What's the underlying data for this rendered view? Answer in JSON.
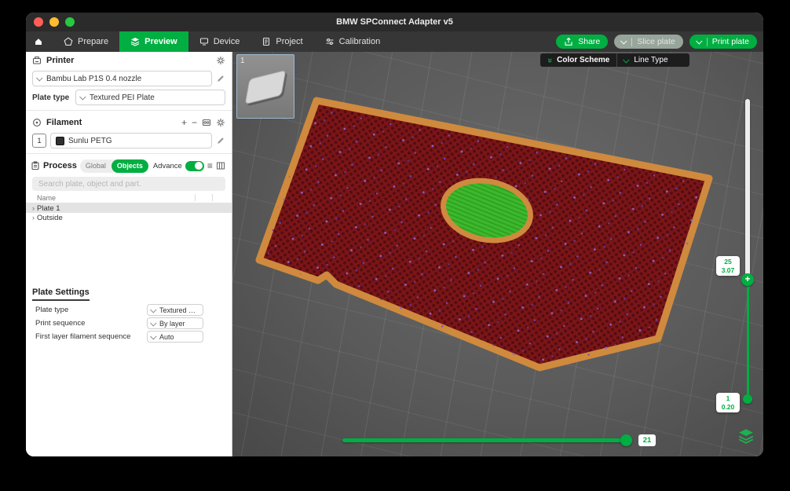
{
  "titlebar": {
    "title": "BMW SPConnect Adapter v5"
  },
  "tabbar": {
    "tabs": [
      {
        "label": "Prepare"
      },
      {
        "label": "Preview"
      },
      {
        "label": "Device"
      },
      {
        "label": "Project"
      },
      {
        "label": "Calibration"
      }
    ],
    "share_label": "Share",
    "slice_label": "Slice plate",
    "print_label": "Print plate"
  },
  "sidebar": {
    "printer": {
      "title": "Printer",
      "model": "Bambu Lab P1S 0.4 nozzle",
      "plate_type_label": "Plate type",
      "plate_type": "Textured PEI Plate"
    },
    "filament": {
      "title": "Filament",
      "slot": "1",
      "name": "Sunlu PETG"
    },
    "process": {
      "title": "Process",
      "seg_global": "Global",
      "seg_objects": "Objects",
      "advance": "Advance"
    },
    "search": {
      "placeholder": "Search plate, object and part."
    },
    "tree": {
      "name_header": "Name",
      "items": [
        {
          "label": "Plate 1"
        },
        {
          "label": "Outside"
        }
      ]
    },
    "plate_settings": {
      "title": "Plate Settings",
      "rows": [
        {
          "label": "Plate type",
          "value": "Textured PEI ..."
        },
        {
          "label": "Print sequence",
          "value": "By layer"
        },
        {
          "label": "First layer filament sequence",
          "value": "Auto"
        }
      ]
    }
  },
  "viewport": {
    "thumbnail": {
      "number": "1"
    },
    "color_scheme": {
      "label": "Color Scheme",
      "value": "Line Type"
    },
    "layer_slider": {
      "top_layer": "25",
      "top_height_mm": "3.07",
      "bottom_layer": "1",
      "bottom_height_mm": "0.20"
    },
    "move_slider": {
      "value": "21"
    }
  },
  "icons": {
    "plus": "+",
    "minus": "−",
    "list": "≡",
    "caret": "›",
    "double_chevron": "»"
  },
  "colors": {
    "accent": "#00AE42",
    "viewport_bg": "#5a5a5a",
    "plate_body": "#7c1518",
    "plate_rim": "#cf8a3e",
    "center_infill": "#3cb82c",
    "speck_purple": "#7a5cc5"
  }
}
